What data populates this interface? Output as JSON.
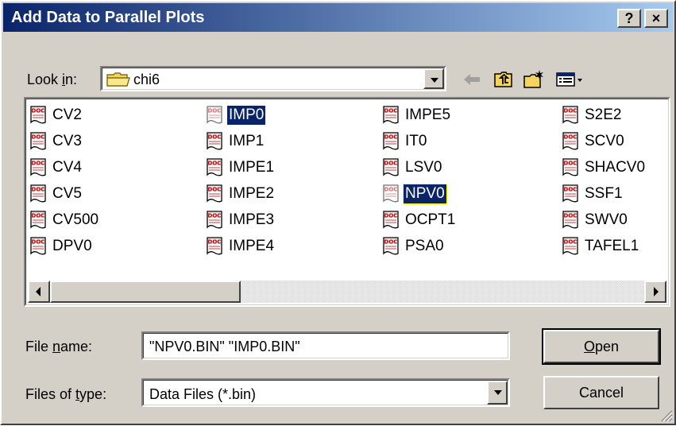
{
  "window": {
    "title": "Add Data to Parallel Plots",
    "help_label": "?",
    "close_label": "×"
  },
  "look_in": {
    "label_pre": "Look ",
    "label_accel": "i",
    "label_post": "n:",
    "value": "chi6",
    "icon": "folder-icon"
  },
  "toolbar": {
    "back_icon": "back-arrow-icon",
    "up_icon": "up-folder-icon",
    "new_folder_icon": "new-folder-icon",
    "view_icon": "view-menu-icon"
  },
  "files": {
    "columns": [
      [
        "CV2",
        "CV3",
        "CV4",
        "CV5",
        "CV500",
        "DPV0"
      ],
      [
        "IMP0",
        "IMP1",
        "IMPE1",
        "IMPE2",
        "IMPE3",
        "IMPE4"
      ],
      [
        "IMPE5",
        "IT0",
        "LSV0",
        "NPV0",
        "OCPT1",
        "PSA0"
      ],
      [
        "S2E2",
        "SCV0",
        "SHACV0",
        "SSF1",
        "SWV0",
        "TAFEL1"
      ]
    ],
    "selected": [
      "IMP0",
      "NPV0"
    ],
    "focused": "NPV0"
  },
  "file_name": {
    "label_pre": "File ",
    "label_accel": "n",
    "label_post": "ame:",
    "value": "\"NPV0.BIN\" \"IMP0.BIN\""
  },
  "file_type": {
    "label_pre": "Files of ",
    "label_accel": "t",
    "label_post": "ype:",
    "value": "Data Files (*.bin)"
  },
  "buttons": {
    "open_accel": "O",
    "open_rest": "pen",
    "cancel": "Cancel"
  },
  "colors": {
    "title_start": "#0a246a",
    "title_end": "#a6caf0",
    "face": "#d4d0c8",
    "selection": "#0a246a"
  }
}
